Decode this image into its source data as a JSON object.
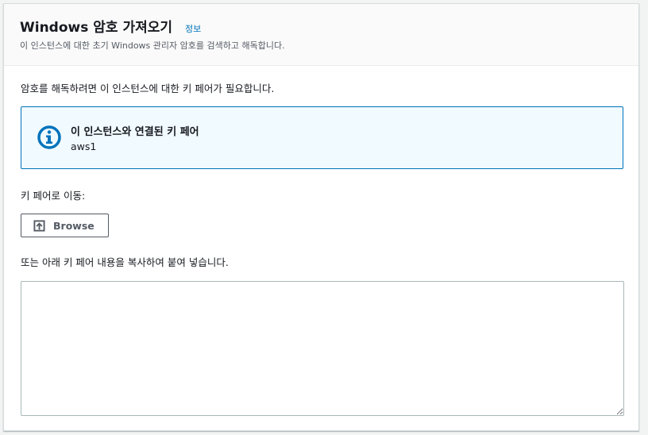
{
  "header": {
    "title": "Windows 암호 가져오기",
    "info_link": "정보",
    "subtitle": "이 인스턴스에 대한 초기 Windows 관리자 암호를 검색하고 해독합니다."
  },
  "main": {
    "intro_text": "암호를 해독하려면 이 인스턴스에 대한 키 페어가 필요합니다.",
    "alert": {
      "icon": "info-icon",
      "title": "이 인스턴스와 연결된 키 페어",
      "value": "aws1",
      "color": "#0073bb"
    },
    "navigate_label": "키 페어로 이동:",
    "browse_button": {
      "label": "Browse",
      "icon": "upload-icon"
    },
    "paste_label": "또는 아래 키 페어 내용을 복사하여 붙여 넣습니다.",
    "key_textarea": {
      "value": "",
      "placeholder": ""
    }
  }
}
